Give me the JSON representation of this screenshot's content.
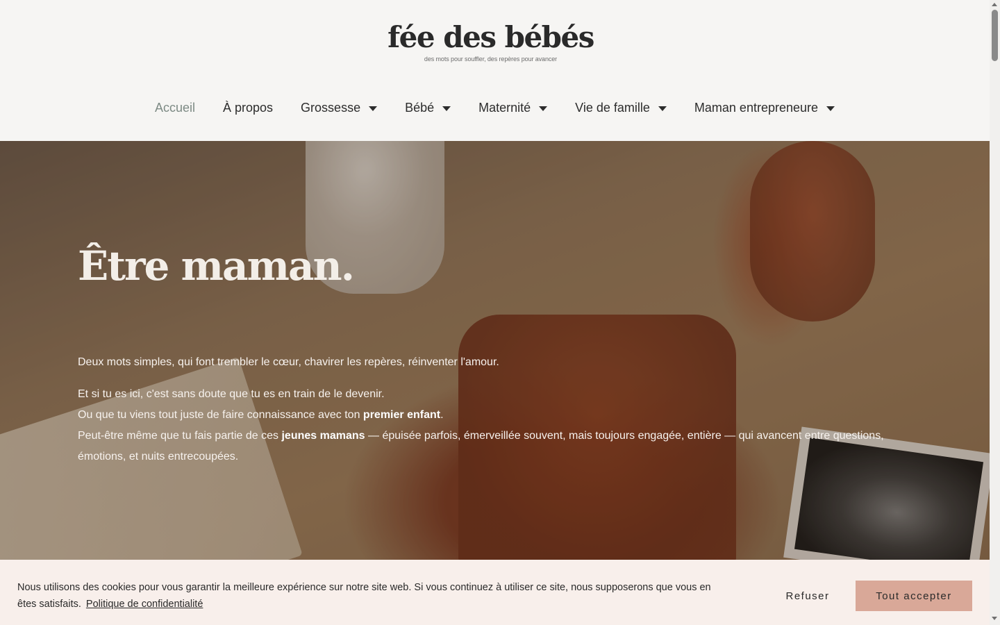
{
  "logo": {
    "title": "fée des bébés",
    "tagline": "des mots pour souffler, des repères pour avancer"
  },
  "nav": {
    "items": [
      {
        "label": "Accueil",
        "active": true,
        "dropdown": false
      },
      {
        "label": "À propos",
        "active": false,
        "dropdown": false
      },
      {
        "label": "Grossesse",
        "active": false,
        "dropdown": true
      },
      {
        "label": "Bébé",
        "active": false,
        "dropdown": true
      },
      {
        "label": "Maternité",
        "active": false,
        "dropdown": true
      },
      {
        "label": "Vie de famille",
        "active": false,
        "dropdown": true
      },
      {
        "label": "Maman entrepreneure",
        "active": false,
        "dropdown": true
      }
    ]
  },
  "hero": {
    "title": "Être maman.",
    "p1": "Deux mots simples, qui font trembler le cœur, chavirer les repères, réinventer l'amour.",
    "line1": "Et si tu es ici, c'est sans doute que tu es en train de le devenir.",
    "line2_before": "Ou que tu viens tout juste de faire connaissance avec ton ",
    "line2_bold": "premier enfant",
    "line2_after": ".",
    "line3_before": "Peut-être même que tu fais partie de ces ",
    "line3_bold": "jeunes mamans",
    "line3_after": " — épuisée parfois, émerveillée souvent, mais toujours engagée, entière — qui avancent entre questions, émotions, et nuits entrecoupées."
  },
  "cookie": {
    "text": "Nous utilisons des cookies pour vous garantir la meilleure expérience sur notre site web. Si vous continuez à utiliser ce site, nous supposerons que vous en êtes satisfaits.",
    "link": "Politique de confidentialité",
    "refuse": "Refuser",
    "accept": "Tout accepter"
  },
  "colors": {
    "accent": "#d9a898",
    "active_nav": "#7d8a84",
    "banner_bg": "#f8efeb"
  }
}
